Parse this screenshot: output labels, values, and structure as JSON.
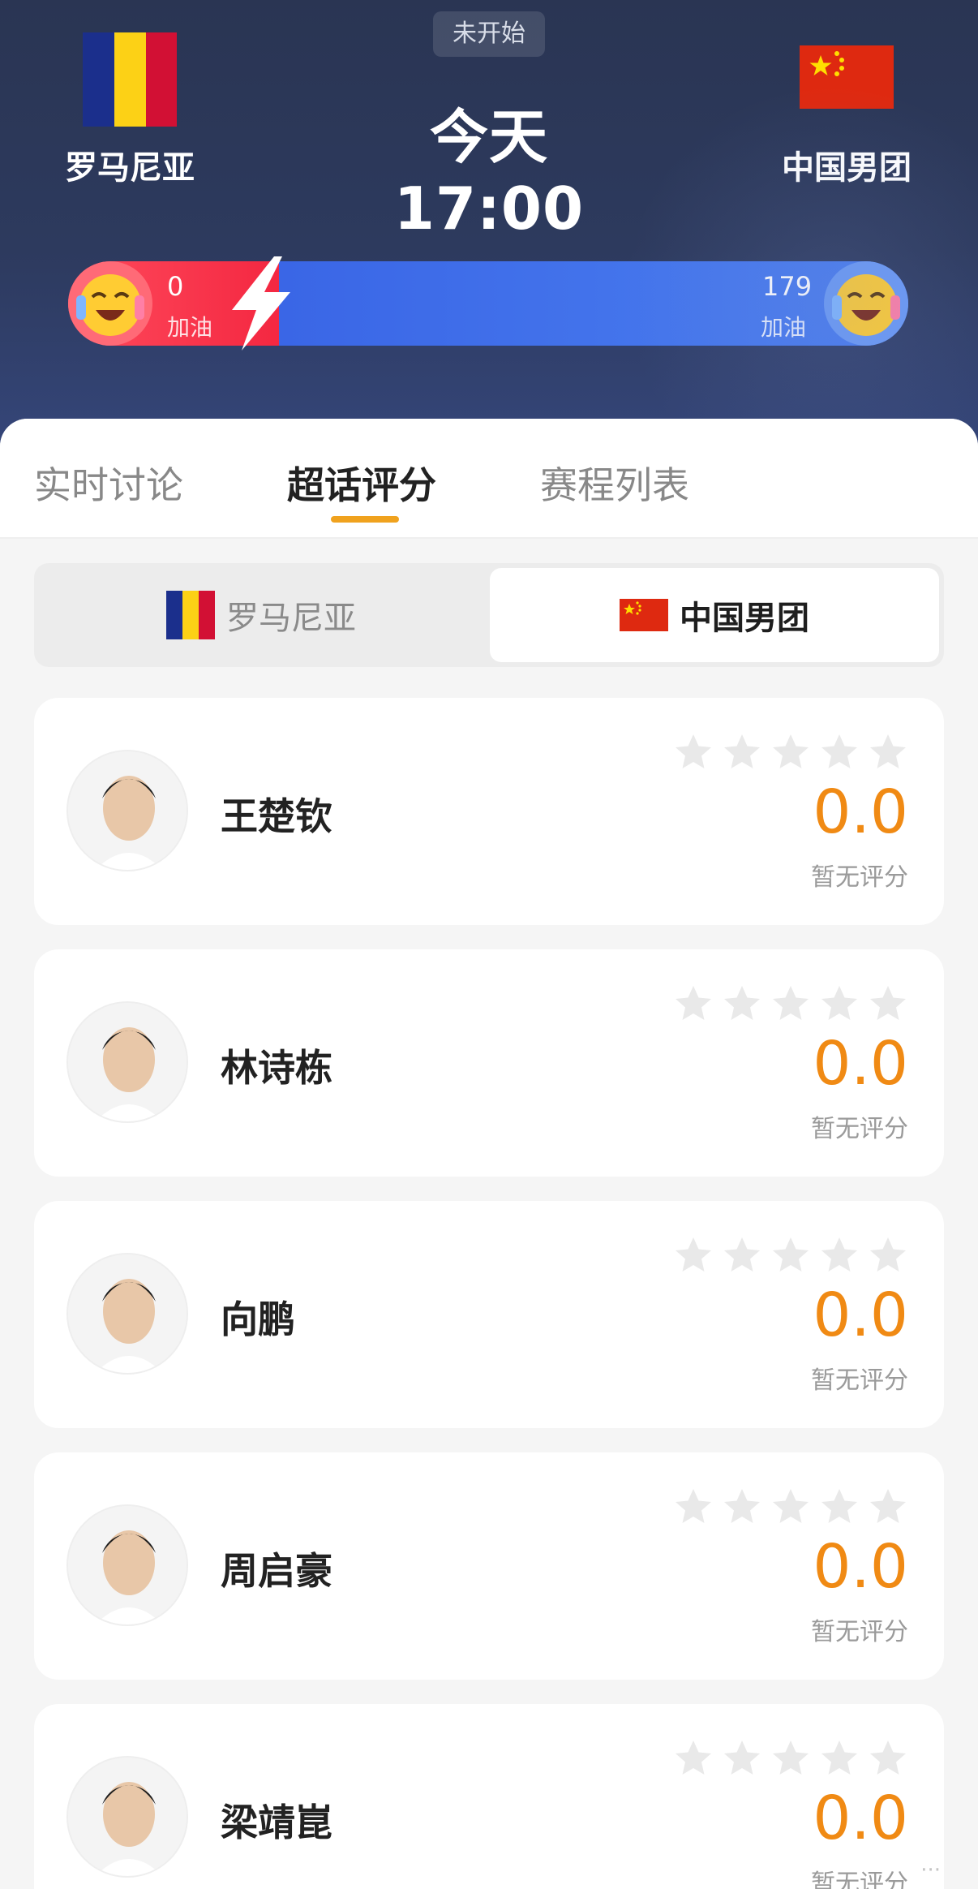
{
  "header": {
    "status": "未开始",
    "time": "今天 17:00",
    "home": {
      "name": "罗马尼亚",
      "cheer_count": "0",
      "cheer_label": "加油"
    },
    "away": {
      "name": "中国男团",
      "cheer_count": "179",
      "cheer_label": "加油"
    }
  },
  "tabs": [
    {
      "label": "实时讨论",
      "active": false
    },
    {
      "label": "超话评分",
      "active": true
    },
    {
      "label": "赛程列表",
      "active": false
    }
  ],
  "team_toggle": {
    "home": "罗马尼亚",
    "away": "中国男团",
    "selected": "away"
  },
  "rating": {
    "max_stars": 5,
    "filled_stars": 0
  },
  "players": [
    {
      "name": "王楚钦",
      "score": "0.0",
      "note": "暂无评分"
    },
    {
      "name": "林诗栋",
      "score": "0.0",
      "note": "暂无评分"
    },
    {
      "name": "向鹏",
      "score": "0.0",
      "note": "暂无评分"
    },
    {
      "name": "周启豪",
      "score": "0.0",
      "note": "暂无评分"
    },
    {
      "name": "梁靖崑",
      "score": "0.0",
      "note": "暂无评分"
    }
  ],
  "colors": {
    "accent": "#f0a21e",
    "score": "#f08a14",
    "cheer_home": "#f2223d",
    "cheer_away": "#3a66e6"
  }
}
